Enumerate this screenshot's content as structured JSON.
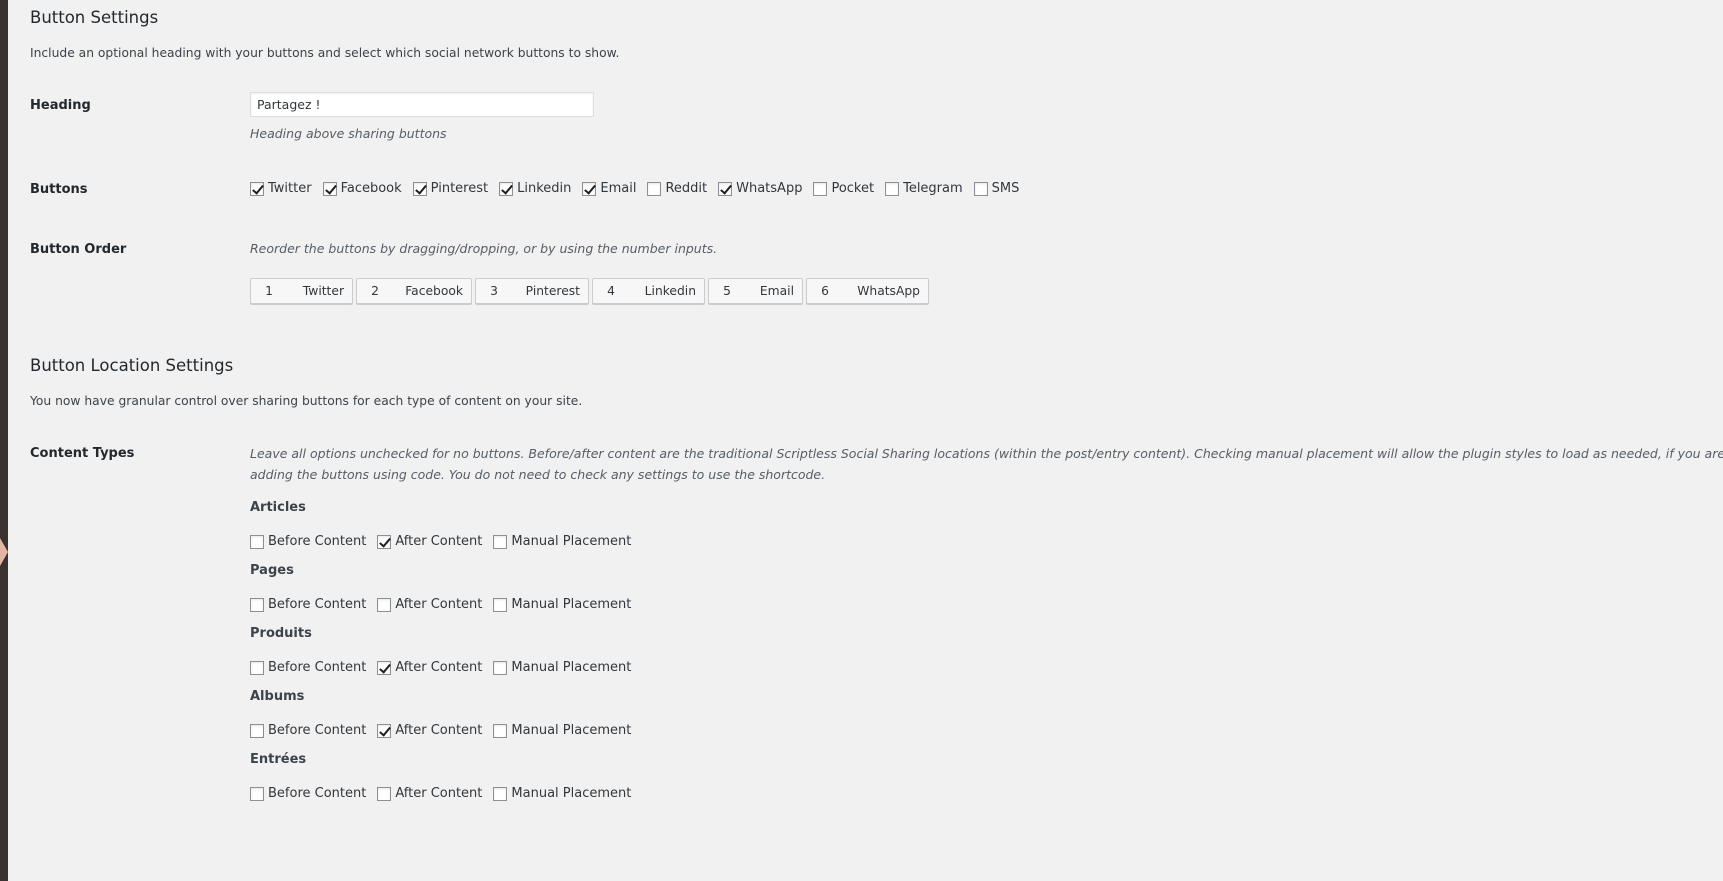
{
  "button_settings": {
    "title": "Button Settings",
    "description": "Include an optional heading with your buttons and select which social network buttons to show.",
    "heading_label": "Heading",
    "heading_value": "Partagez !",
    "heading_hint": "Heading above sharing buttons",
    "buttons_label": "Buttons",
    "buttons": [
      {
        "label": "Twitter",
        "checked": true
      },
      {
        "label": "Facebook",
        "checked": true
      },
      {
        "label": "Pinterest",
        "checked": true
      },
      {
        "label": "Linkedin",
        "checked": true
      },
      {
        "label": "Email",
        "checked": true
      },
      {
        "label": "Reddit",
        "checked": false
      },
      {
        "label": "WhatsApp",
        "checked": true
      },
      {
        "label": "Pocket",
        "checked": false
      },
      {
        "label": "Telegram",
        "checked": false
      },
      {
        "label": "SMS",
        "checked": false
      }
    ],
    "order_label": "Button Order",
    "order_hint": "Reorder the buttons by dragging/dropping, or by using the number inputs.",
    "order": [
      {
        "num": "1",
        "name": "Twitter"
      },
      {
        "num": "2",
        "name": "Facebook"
      },
      {
        "num": "3",
        "name": "Pinterest"
      },
      {
        "num": "4",
        "name": "Linkedin"
      },
      {
        "num": "5",
        "name": "Email"
      },
      {
        "num": "6",
        "name": "WhatsApp"
      }
    ]
  },
  "location_settings": {
    "title": "Button Location Settings",
    "description": "You now have granular control over sharing buttons for each type of content on your site.",
    "content_types_label": "Content Types",
    "content_types_hint": "Leave all options unchecked for no buttons. Before/after content are the traditional Scriptless Social Sharing locations (within the post/entry content). Checking manual placement will allow the plugin styles to load as needed, if you are adding the buttons using code. You do not need to check any settings to use the shortcode.",
    "option_labels": [
      "Before Content",
      "After Content",
      "Manual Placement"
    ],
    "types": [
      {
        "name": "Articles",
        "checked": [
          false,
          true,
          false
        ]
      },
      {
        "name": "Pages",
        "checked": [
          false,
          false,
          false
        ]
      },
      {
        "name": "Produits",
        "checked": [
          false,
          true,
          false
        ]
      },
      {
        "name": "Albums",
        "checked": [
          false,
          true,
          false
        ]
      },
      {
        "name": "Entrées",
        "checked": [
          false,
          false,
          false
        ]
      }
    ]
  },
  "colors": {
    "background": "#f1f1f1",
    "sidebar": "#3a3330",
    "collapse_arrow": "#e3b6a3"
  }
}
